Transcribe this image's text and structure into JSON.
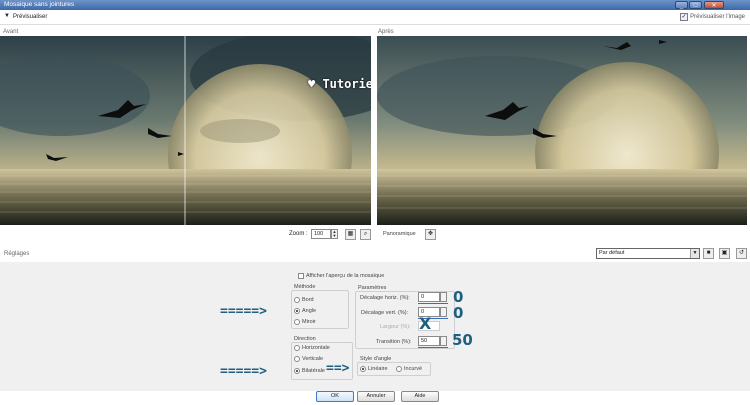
{
  "window": {
    "title": "Mosaique sans jointures",
    "min_glyph": "_",
    "max_glyph": "□",
    "close_glyph": "✕"
  },
  "toolbar": {
    "collapse_glyph": "▼",
    "preview_label": "Prévisualiser",
    "preview_image_checked": true,
    "preview_image_label": "Prévisualiser l'image",
    "check_glyph": "✓"
  },
  "preview": {
    "before_label": "Avant",
    "after_label": "Après",
    "watermark": "♥ Tutoriel by Sweety ♥"
  },
  "zoom": {
    "label": "Zoom :",
    "value": "100",
    "pan_label": "Panoramique",
    "up_glyph": "▲",
    "down_glyph": "▼",
    "fit_glyph": "▦",
    "zoom_glyph": "⌕",
    "pan_glyph": "✥"
  },
  "settings": {
    "title": "Réglages",
    "preset": "Par défaut",
    "preset_arrow": "▼",
    "save_glyph": "■",
    "delete_glyph": "▣",
    "reset_glyph": "↺"
  },
  "options": {
    "show_mosaic_label": "Afficher l'aperçu de la mosaïque",
    "methode": {
      "title": "Méthode",
      "items": [
        "Bord",
        "Angle",
        "Miroir"
      ],
      "selected": "Angle"
    },
    "direction": {
      "title": "Direction",
      "items": [
        "Horizontale",
        "Verticale",
        "Bilatérale"
      ],
      "selected": "Bilatérale"
    },
    "parametres": {
      "title": "Paramètres",
      "fields": [
        {
          "label": "Décalage horiz. (%):",
          "value": "0",
          "enabled": true
        },
        {
          "label": "Décalage vert. (%):",
          "value": "0",
          "enabled": true
        },
        {
          "label": "Largeur (%):",
          "value": "",
          "enabled": false
        },
        {
          "label": "Transition (%):",
          "value": "50",
          "enabled": true
        }
      ]
    },
    "style_angle": {
      "title": "Style d'angle",
      "items": [
        "Linéaire",
        "Incurvé"
      ],
      "selected": "Linéaire"
    }
  },
  "annotations": {
    "arrow_long": "=====>",
    "arrow_short": "==>",
    "zero": "0",
    "cross": "X",
    "fifty": "50"
  },
  "buttons": {
    "ok": "OK",
    "cancel": "Annuler",
    "help": "Aide"
  }
}
